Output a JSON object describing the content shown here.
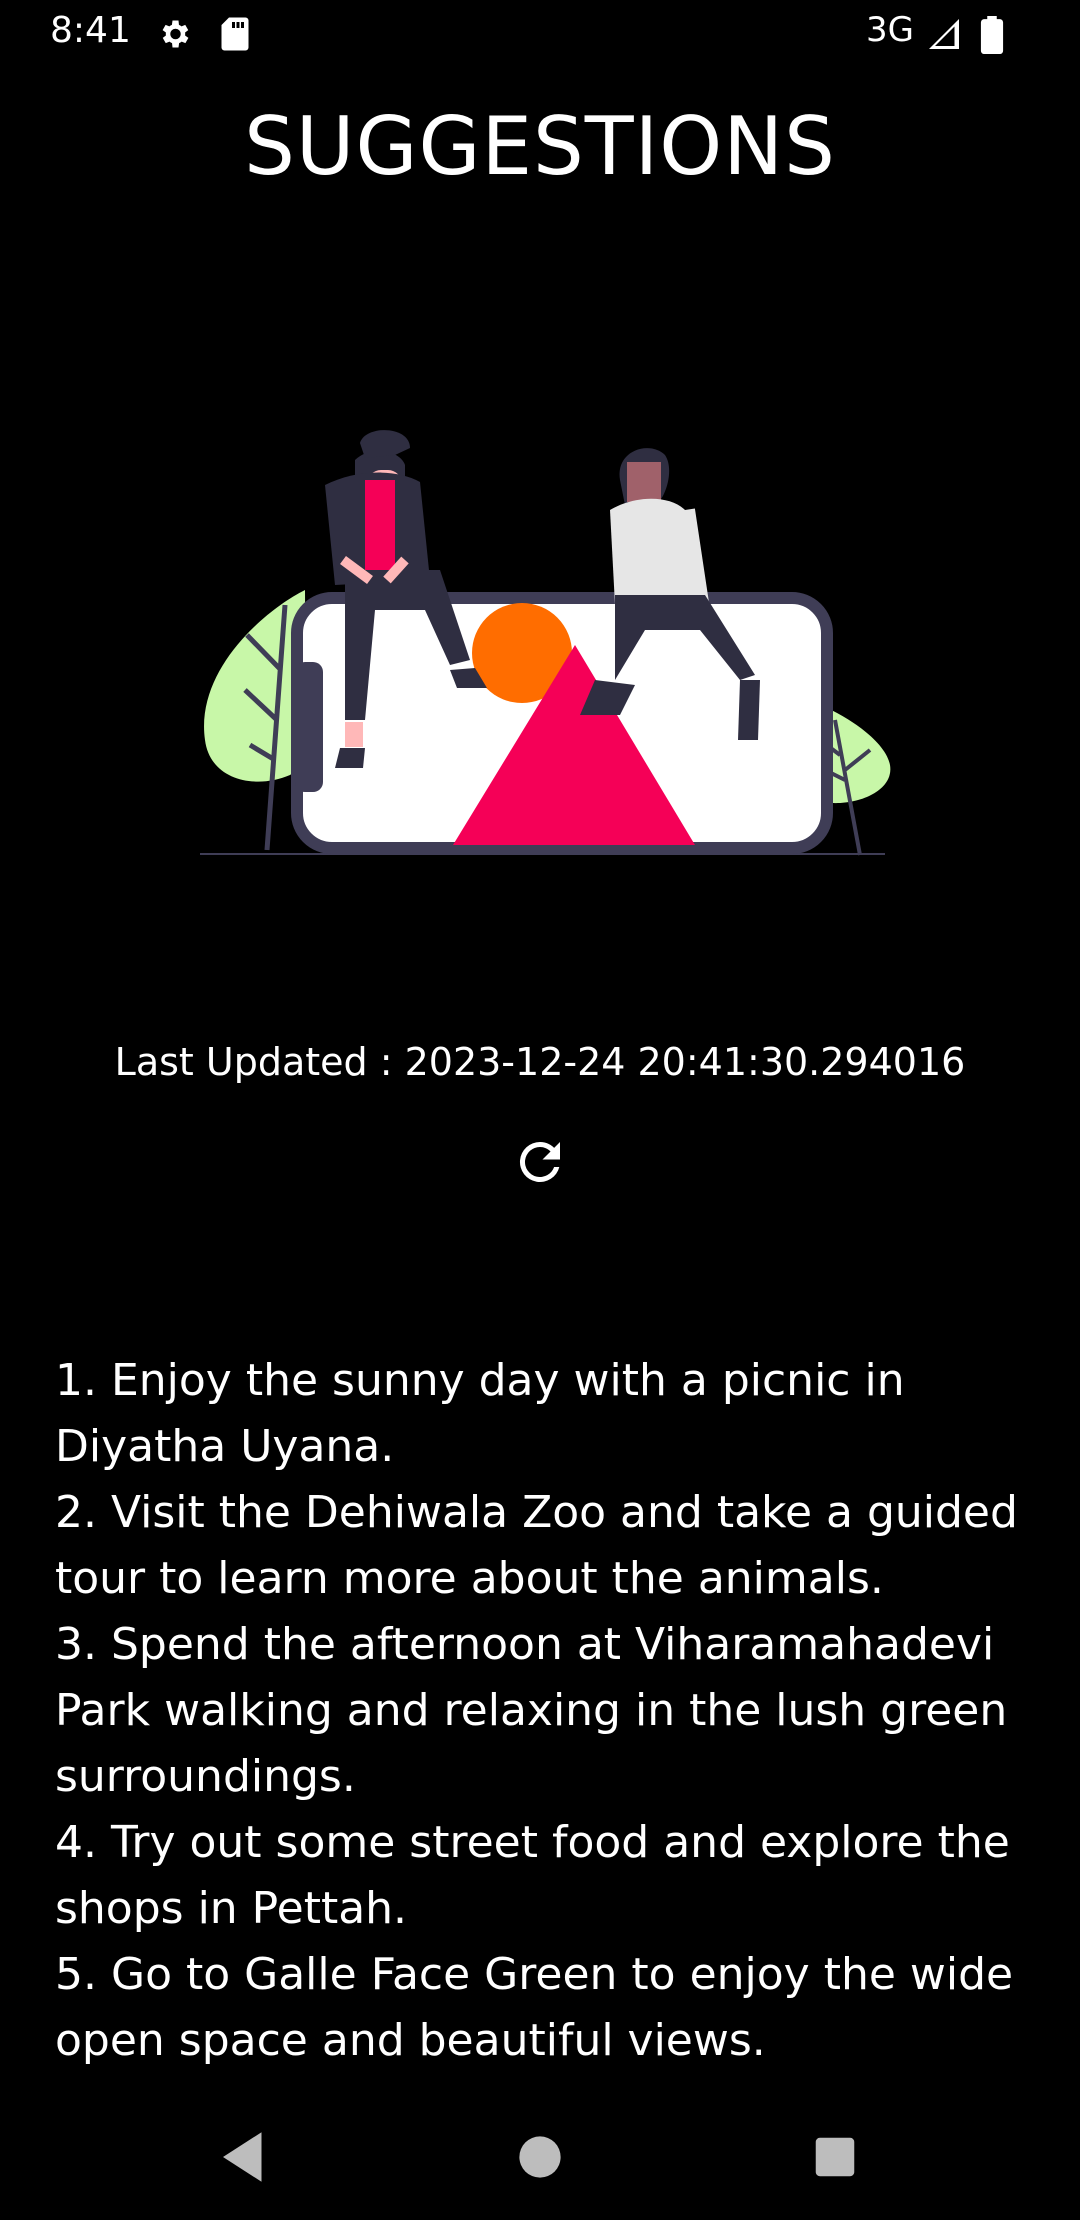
{
  "status_bar": {
    "time": "8:41",
    "network": "3G",
    "icons": [
      "settings-icon",
      "sd-card-icon",
      "signal-icon",
      "battery-icon"
    ]
  },
  "page": {
    "title": "SUGGESTIONS",
    "last_updated": "Last Updated : 2023-12-24 20:41:30.294016",
    "refresh_icon": "refresh-icon",
    "suggestions": [
      "1. Enjoy the sunny day with a picnic in Diyatha Uyana.",
      "2. Visit the Dehiwala Zoo and take a guided tour to learn more about the animals.",
      "3. Spend the afternoon at Viharamahadevi Park walking and relaxing in the lush green surroundings.",
      "4. Try out some street food and explore the shops in Pettah.",
      "5. Go to Galle Face Green to enjoy the wide open space and beautiful views."
    ]
  },
  "nav_bar": {
    "icons": [
      "back-icon",
      "home-icon",
      "recents-icon"
    ]
  },
  "colors": {
    "background": "#000000",
    "text": "#ffffff",
    "accent_pink": "#f50057",
    "accent_orange": "#ff6d00",
    "leaf_green": "#c8f7a8",
    "dark_figure": "#3f3d56"
  }
}
